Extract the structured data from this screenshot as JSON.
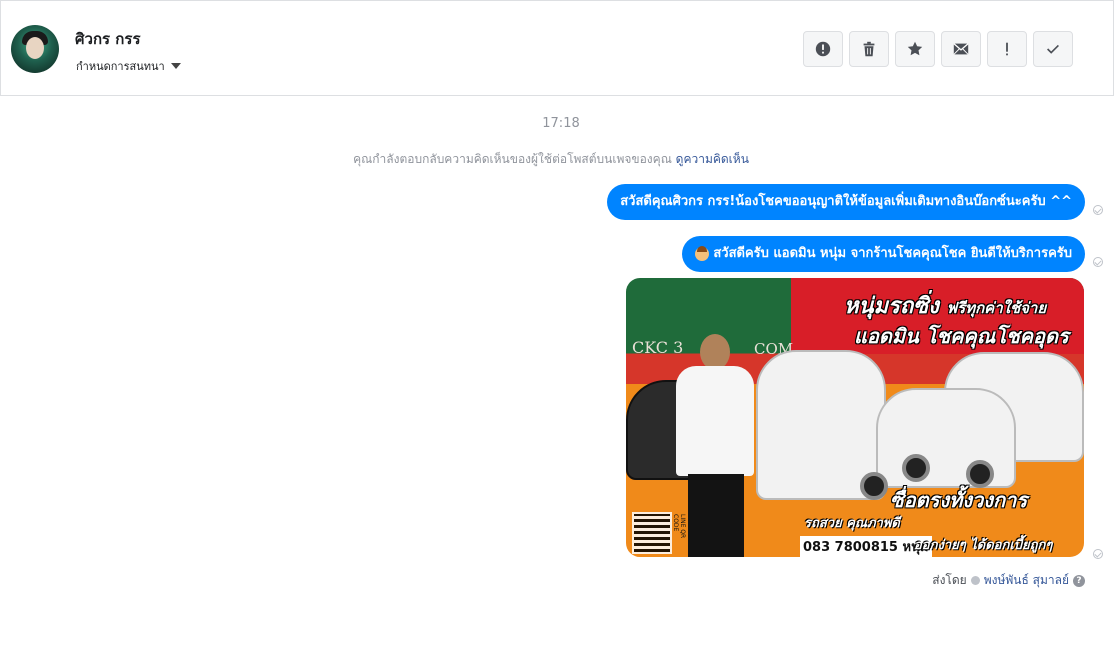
{
  "header": {
    "contact_name": "ศิวกร กรร",
    "assign_label": "กำหนดการสนทนา",
    "toolbar": [
      {
        "icon": "alert-circle-icon",
        "label": "!"
      },
      {
        "icon": "trash-icon",
        "label": ""
      },
      {
        "icon": "star-icon",
        "label": ""
      },
      {
        "icon": "envelope-icon",
        "label": ""
      },
      {
        "icon": "exclamation-icon",
        "label": "!"
      },
      {
        "icon": "check-icon",
        "label": ""
      }
    ]
  },
  "conversation": {
    "time": "17:18",
    "reply_note": "คุณกำลังตอบกลับความคิดเห็นของผู้ใช้ต่อโพสต์บนเพจของคุณ",
    "reply_link": "ดูความคิดเห็น",
    "messages": [
      {
        "text": "สวัสดีคุณศิวกร กรร!น้องโชคขออนุญาติให้ข้อมูลเพิ่มเติมทางอินบ๊อกซ์นะครับ ^^"
      },
      {
        "text": "สวัสดีครับ แอดมิน หนุ่ม จากร้านโชคคุณโชค ยินดีให้บริการครับ"
      }
    ],
    "ad_image": {
      "headline": "หนุ่มรถซิ่ง",
      "headline_small": "ฟรีทุกค่าใช้จ่าย",
      "subheadline": "แอดมิน โชคคุณโชคอุดร",
      "tagline": "ซื่อตรงทั้งวงการ",
      "quality": "รถสวย คุณภาพดี",
      "phone": "083 7800815 หนุ่ม",
      "slogan": "ออกง่ายๆ ได้ดอกเบี้ยถูกๆ",
      "brand_left": "CKC 3",
      "brand_right": "COM",
      "qr_caption": "LINE QR CODE"
    },
    "sent_by_label": "ส่งโดย",
    "sent_by_name": "พงษ์พันธ์ สุมาลย์"
  },
  "colors": {
    "bubble": "#0084ff",
    "link": "#365899",
    "muted": "#90949c"
  }
}
